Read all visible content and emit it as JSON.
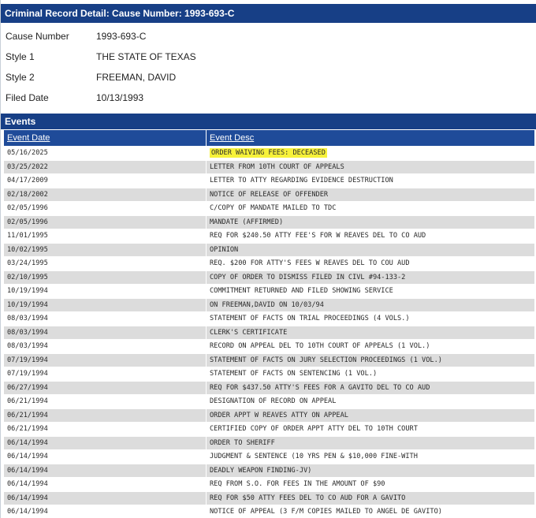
{
  "header": {
    "title": "Criminal Record Detail: Cause Number: 1993-693-C"
  },
  "details": [
    {
      "label": "Cause Number",
      "value": "1993-693-C"
    },
    {
      "label": "Style 1",
      "value": "THE STATE OF TEXAS"
    },
    {
      "label": "Style 2",
      "value": "FREEMAN, DAVID"
    },
    {
      "label": "Filed Date",
      "value": "10/13/1993"
    }
  ],
  "events": {
    "title": "Events",
    "columns": [
      "Event Date",
      "Event Desc"
    ],
    "highlight_color": "#f7f23a",
    "rows": [
      {
        "date": "05/16/2025",
        "desc": "ORDER WAIVING FEES: DECEASED",
        "highlighted": true
      },
      {
        "date": "03/25/2022",
        "desc": "LETTER FROM 10TH COURT OF APPEALS"
      },
      {
        "date": "04/17/2009",
        "desc": "LETTER TO ATTY REGARDING EVIDENCE DESTRUCTION"
      },
      {
        "date": "02/18/2002",
        "desc": "NOTICE OF RELEASE OF OFFENDER"
      },
      {
        "date": "02/05/1996",
        "desc": "C/COPY OF MANDATE MAILED TO TDC"
      },
      {
        "date": "02/05/1996",
        "desc": "MANDATE (AFFIRMED)"
      },
      {
        "date": "11/01/1995",
        "desc": "REQ FOR $240.50 ATTY FEE'S FOR W REAVES DEL TO CO AUD"
      },
      {
        "date": "10/02/1995",
        "desc": "OPINION"
      },
      {
        "date": "03/24/1995",
        "desc": "REQ. $200 FOR ATTY'S FEES W REAVES DEL TO COU AUD"
      },
      {
        "date": "02/10/1995",
        "desc": "COPY OF ORDER TO DISMISS FILED IN CIVL #94-133-2"
      },
      {
        "date": "10/19/1994",
        "desc": "COMMITMENT RETURNED AND FILED SHOWING SERVICE"
      },
      {
        "date": "10/19/1994",
        "desc": "ON FREEMAN,DAVID ON 10/03/94"
      },
      {
        "date": "08/03/1994",
        "desc": "STATEMENT OF FACTS ON TRIAL PROCEEDINGS (4 VOLS.)"
      },
      {
        "date": "08/03/1994",
        "desc": "CLERK'S CERTIFICATE"
      },
      {
        "date": "08/03/1994",
        "desc": "RECORD ON APPEAL DEL TO 10TH COURT OF APPEALS (1 VOL.)"
      },
      {
        "date": "07/19/1994",
        "desc": "STATEMENT OF FACTS ON JURY SELECTION PROCEEDINGS (1 VOL.)"
      },
      {
        "date": "07/19/1994",
        "desc": "STATEMENT OF FACTS ON SENTENCING (1 VOL.)"
      },
      {
        "date": "06/27/1994",
        "desc": "REQ FOR $437.50 ATTY'S FEES FOR A GAVITO DEL TO CO AUD"
      },
      {
        "date": "06/21/1994",
        "desc": "DESIGNATION OF RECORD ON APPEAL"
      },
      {
        "date": "06/21/1994",
        "desc": "ORDER APPT W REAVES ATTY ON APPEAL"
      },
      {
        "date": "06/21/1994",
        "desc": "CERTIFIED COPY OF ORDER APPT ATTY DEL TO 10TH COURT"
      },
      {
        "date": "06/14/1994",
        "desc": "ORDER TO SHERIFF"
      },
      {
        "date": "06/14/1994",
        "desc": "JUDGMENT & SENTENCE (10 YRS PEN & $10,000 FINE-WITH"
      },
      {
        "date": "06/14/1994",
        "desc": "DEADLY WEAPON FINDING-JV)"
      },
      {
        "date": "06/14/1994",
        "desc": "REQ FROM S.O. FOR FEES IN THE AMOUNT OF $90"
      },
      {
        "date": "06/14/1994",
        "desc": "REQ FOR $50 ATTY FEES DEL TO CO AUD FOR A GAVITO"
      },
      {
        "date": "06/14/1994",
        "desc": "NOTICE OF APPEAL (3 F/M COPIES MAILED TO ANGEL DE GAVITO)"
      }
    ]
  }
}
